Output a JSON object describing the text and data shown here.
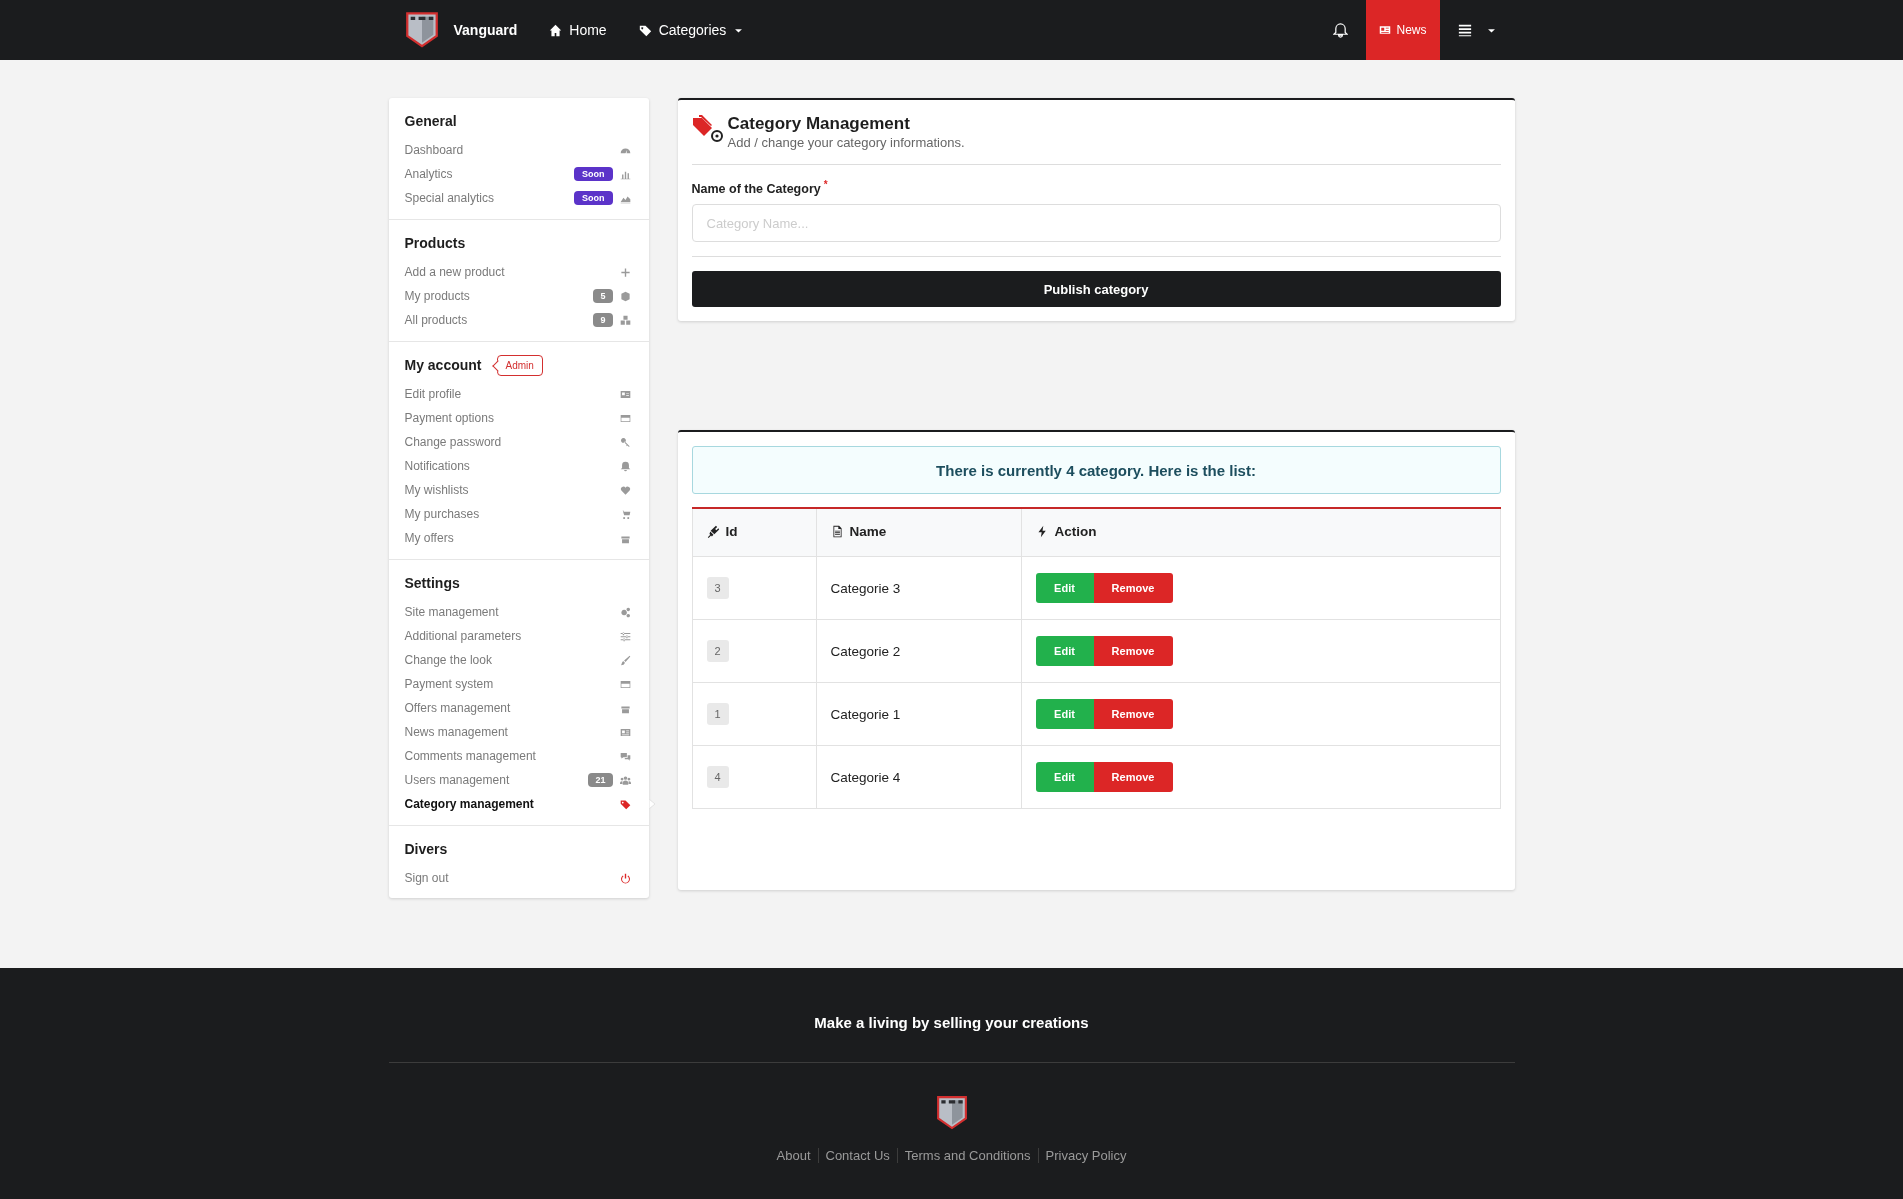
{
  "navbar": {
    "brand": "Vanguard",
    "links": [
      {
        "label": "Home",
        "dropdown": false
      },
      {
        "label": "Categories",
        "dropdown": true
      }
    ],
    "news_button": "News"
  },
  "sidebar": {
    "sections": [
      {
        "title": "General",
        "items": [
          {
            "label": "Dashboard",
            "selected": false
          },
          {
            "label": "Analytics",
            "selected": false,
            "badge": {
              "text": "Soon",
              "kind": "soon"
            }
          },
          {
            "label": "Special analytics",
            "selected": false,
            "badge": {
              "text": "Soon",
              "kind": "soon"
            }
          }
        ]
      },
      {
        "title": "Products",
        "items": [
          {
            "label": "Add a new product",
            "selected": false
          },
          {
            "label": "My products",
            "selected": false,
            "badge": {
              "text": "5",
              "kind": "count"
            }
          },
          {
            "label": "All products",
            "selected": false,
            "badge": {
              "text": "9",
              "kind": "count"
            }
          }
        ]
      },
      {
        "title": "My account",
        "tag": "Admin",
        "items": [
          {
            "label": "Edit profile",
            "selected": false
          },
          {
            "label": "Payment options",
            "selected": false
          },
          {
            "label": "Change password",
            "selected": false
          },
          {
            "label": "Notifications",
            "selected": false
          },
          {
            "label": "My wishlists",
            "selected": false
          },
          {
            "label": "My purchases",
            "selected": false
          },
          {
            "label": "My offers",
            "selected": false
          }
        ]
      },
      {
        "title": "Settings",
        "items": [
          {
            "label": "Site management",
            "selected": false
          },
          {
            "label": "Additional parameters",
            "selected": false
          },
          {
            "label": "Change the look",
            "selected": false
          },
          {
            "label": "Payment system",
            "selected": false
          },
          {
            "label": "Offers management",
            "selected": false
          },
          {
            "label": "News management",
            "selected": false
          },
          {
            "label": "Comments management",
            "selected": false
          },
          {
            "label": "Users management",
            "selected": false,
            "badge": {
              "text": "21",
              "kind": "count"
            }
          },
          {
            "label": "Category management",
            "selected": true
          }
        ]
      },
      {
        "title": "Divers",
        "items": [
          {
            "label": "Sign out",
            "selected": false
          }
        ]
      }
    ]
  },
  "form_card": {
    "title": "Category Management",
    "subtitle": "Add / change your category informations.",
    "field_label": "Name of the Category",
    "required_mark": "*",
    "placeholder": "Category Name...",
    "submit_button": "Publish category"
  },
  "list_card": {
    "alert": "There is currently 4 category. Here is the list:",
    "table": {
      "columns": [
        "Id",
        "Name",
        "Action"
      ],
      "rows": [
        {
          "id": "3",
          "name": "Categorie 3",
          "edit": "Edit",
          "remove": "Remove"
        },
        {
          "id": "2",
          "name": "Categorie 2",
          "edit": "Edit",
          "remove": "Remove"
        },
        {
          "id": "1",
          "name": "Categorie 1",
          "edit": "Edit",
          "remove": "Remove"
        },
        {
          "id": "4",
          "name": "Categorie 4",
          "edit": "Edit",
          "remove": "Remove"
        }
      ]
    }
  },
  "footer": {
    "tagline": "Make a living by selling your creations",
    "links": [
      "About",
      "Contact Us",
      "Terms and Conditions",
      "Privacy Policy"
    ]
  }
}
